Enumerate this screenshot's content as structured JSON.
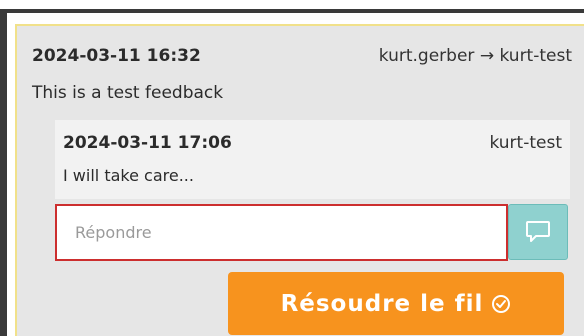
{
  "feedback": {
    "timestamp": "2024-03-11 16:32",
    "authors": "kurt.gerber → kurt-test",
    "message": "This is a test feedback"
  },
  "reply": {
    "timestamp": "2024-03-11 17:06",
    "author": "kurt-test",
    "message": "I will take care..."
  },
  "reply_input": {
    "placeholder": "Répondre",
    "value": ""
  },
  "send_button": {
    "icon": "speech-bubble-icon"
  },
  "resolve_button": {
    "label": "Résoudre le fil",
    "icon": "check-circle-icon"
  },
  "colors": {
    "panel_background": "#e6e6e6",
    "panel_border": "#f1e18a",
    "reply_background": "#f2f2f2",
    "input_border": "#cc2e2e",
    "send_button": "#8fd1cf",
    "resolve_button": "#f7931e"
  }
}
